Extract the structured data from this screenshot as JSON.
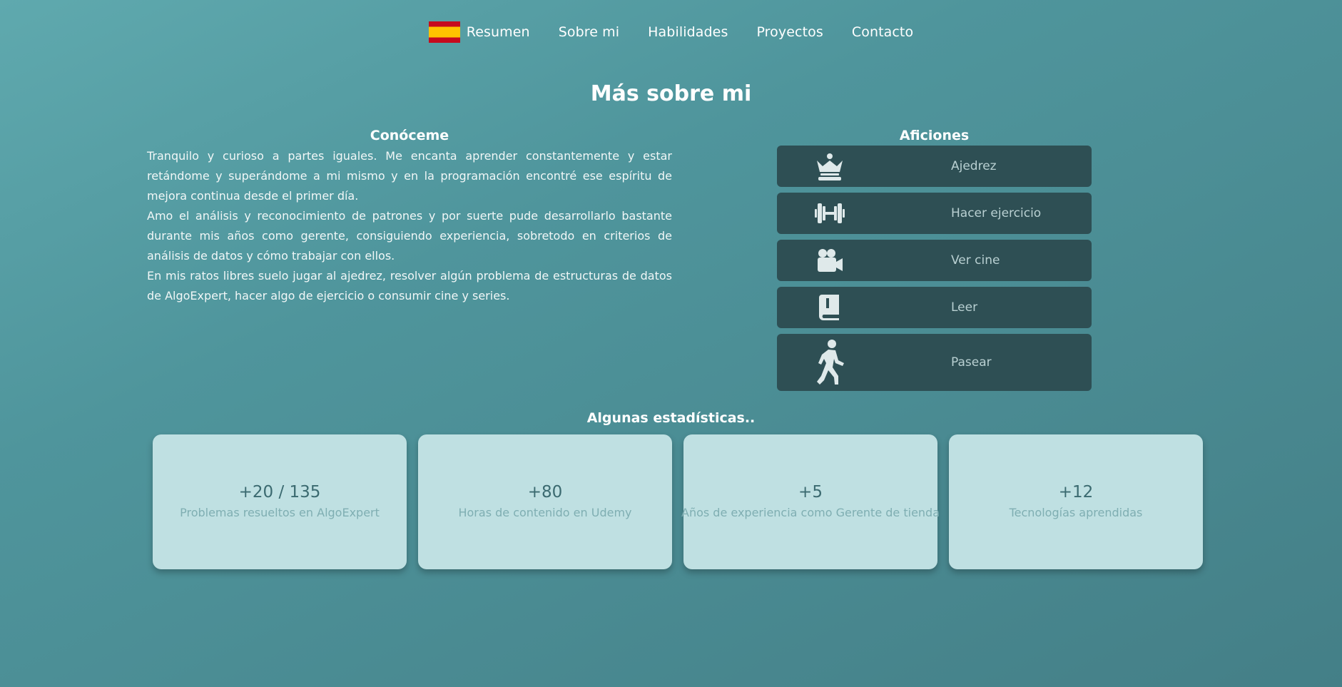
{
  "nav": {
    "flag_icon": "spain-flag-icon",
    "links": [
      "Resumen",
      "Sobre mi",
      "Habilidades",
      "Proyectos",
      "Contacto"
    ]
  },
  "page_title": "Más sobre mi",
  "about": {
    "heading": "Conóceme",
    "paragraphs": [
      "Tranquilo y curioso a partes iguales. Me encanta aprender constantemente y estar retándome y superándome a mi mismo y en la programación encontré ese espíritu de mejora continua desde el primer día.",
      "Amo el análisis y reconocimiento de patrones y por suerte pude desarrollarlo bastante durante mis años como gerente, consiguiendo experiencia, sobretodo en criterios de análisis de datos y cómo trabajar con ellos.",
      "En mis ratos libres suelo jugar al ajedrez, resolver algún problema de estructuras de datos de AlgoExpert, hacer algo de ejercicio o consumir cine y series."
    ]
  },
  "hobbies": {
    "heading": "Aficiones",
    "items": [
      {
        "label": "Ajedrez",
        "icon": "chess-queen-icon"
      },
      {
        "label": "Hacer ejercicio",
        "icon": "dumbbell-icon"
      },
      {
        "label": "Ver cine",
        "icon": "video-camera-icon"
      },
      {
        "label": "Leer",
        "icon": "book-icon"
      },
      {
        "label": "Pasear",
        "icon": "walking-icon"
      }
    ]
  },
  "stats": {
    "heading": "Algunas estadísticas..",
    "items": [
      {
        "value": "+20 / 135",
        "label": "Problemas resueltos en AlgoExpert"
      },
      {
        "value": "+80",
        "label": "Horas de contenido en Udemy"
      },
      {
        "value": "+5",
        "label": "Años de experiencia como Gerente de tienda"
      },
      {
        "value": "+12",
        "label": "Tecnologías aprendidas"
      }
    ]
  },
  "colors": {
    "background_start": "#5fa9ae",
    "background_end": "#447f87",
    "hobby_card": "#2e4f54",
    "stat_card": "#bfe0e2",
    "icon": "#dfe9ea"
  }
}
